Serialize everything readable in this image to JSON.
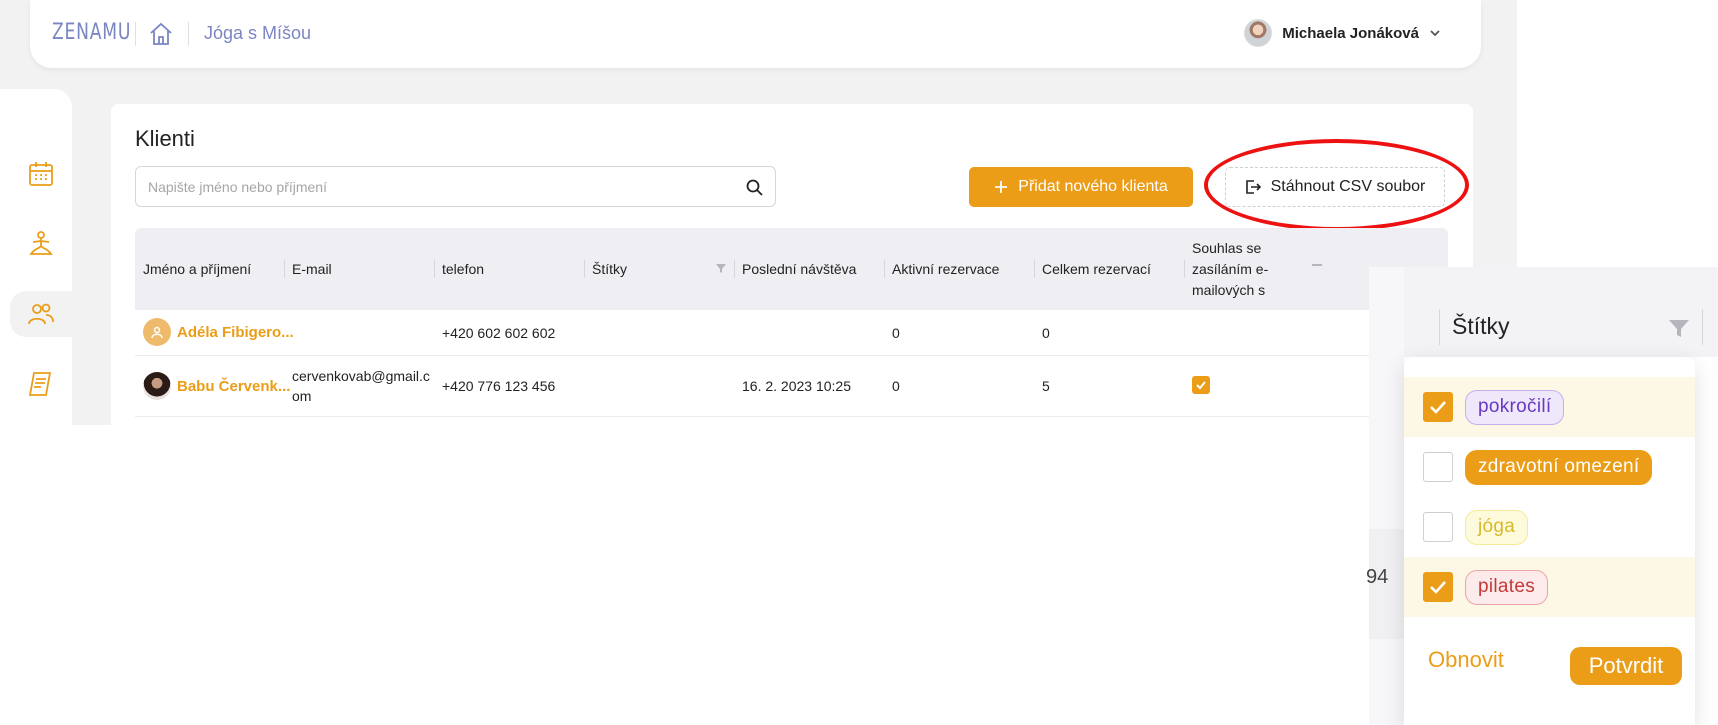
{
  "header": {
    "logo": "ZENAMU",
    "breadcrumb": "Jóga s Míšou",
    "user_name": "Michaela Jonáková"
  },
  "sidebar": {
    "items": [
      {
        "name": "calendar",
        "icon": "calendar-icon"
      },
      {
        "name": "yoga",
        "icon": "yoga-pose-icon"
      },
      {
        "name": "clients",
        "icon": "users-icon",
        "active": true
      },
      {
        "name": "reports",
        "icon": "document-icon"
      }
    ]
  },
  "page": {
    "title": "Klienti",
    "search_placeholder": "Napište jméno nebo příjmení",
    "add_button": "Přidat nového klienta",
    "csv_button": "Stáhnout CSV soubor"
  },
  "table": {
    "columns": {
      "name": "Jméno a příjmení",
      "email": "E-mail",
      "phone": "telefon",
      "tags": "Štítky",
      "last_visit": "Poslední návštěva",
      "active_res": "Aktivní rezervace",
      "total_res": "Celkem rezervací",
      "consent": "Souhlas se zasíláním e-mailových s"
    },
    "rows": [
      {
        "name": "Adéla Fibigero...",
        "email": "",
        "phone": "+420 602 602 602",
        "last_visit": "",
        "active": "0",
        "total": "0",
        "consent": false
      },
      {
        "name": "Babu Červenk...",
        "email": "cervenkovab@gmail.com",
        "email_line1": "cervenkovab@gmail.c",
        "email_line2": "om",
        "phone": "+420 776 123 456",
        "last_visit": "16. 2. 2023 10:25",
        "active": "0",
        "total": "5",
        "consent": true
      }
    ]
  },
  "filter_panel": {
    "title": "Štítky",
    "partial_value": "94",
    "options": [
      {
        "label": "pokročilí",
        "checked": true,
        "color": "purple"
      },
      {
        "label": "zdravotní omezení",
        "checked": false,
        "color": "orange"
      },
      {
        "label": "jóga",
        "checked": false,
        "color": "yellow"
      },
      {
        "label": "pilates",
        "checked": true,
        "color": "red"
      }
    ],
    "reset_label": "Obnovit",
    "confirm_label": "Potvrdit"
  },
  "colors": {
    "accent": "#eb9d18",
    "brand": "#7b85c2",
    "highlight": "#ee1111"
  }
}
